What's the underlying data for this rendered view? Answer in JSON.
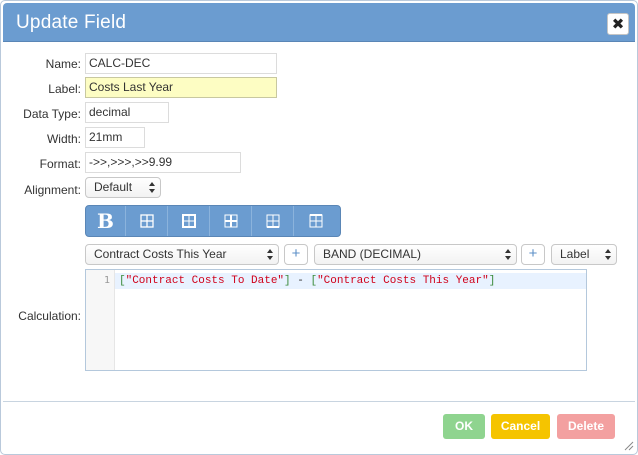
{
  "dialog": {
    "title": "Update Field",
    "close_icon": "close-icon"
  },
  "form": {
    "name": {
      "label": "Name:",
      "value": "CALC-DEC"
    },
    "label": {
      "label": "Label:",
      "value": "Costs Last Year"
    },
    "data_type": {
      "label": "Data Type:",
      "value": "decimal"
    },
    "width": {
      "label": "Width:",
      "value": "21mm"
    },
    "format": {
      "label": "Format:",
      "value": "->>,>>>,>>9.99"
    },
    "alignment": {
      "label": "Alignment:",
      "value": "Default"
    }
  },
  "toolbar": {
    "bold_label": "B",
    "icons": [
      "bold-icon",
      "border-all-icon",
      "border-outer-icon",
      "border-inner-icon",
      "border-bottom-icon",
      "border-top-icon"
    ]
  },
  "calc_row": {
    "field_select": "Contract Costs This Year",
    "band_select": "BAND (DECIMAL)",
    "type_select": "Label",
    "plus": "+"
  },
  "calculation": {
    "label": "Calculation:",
    "line_number": "1",
    "tokens": {
      "open1": "[",
      "str1": "\"Contract Costs To Date\"",
      "close1": "]",
      "op": " - ",
      "open2": "[",
      "str2": "\"Contract Costs This Year\"",
      "close2": "]"
    }
  },
  "buttons": {
    "ok": "OK",
    "cancel": "Cancel",
    "delete": "Delete"
  },
  "colors": {
    "titlebar": "#6b9cd0",
    "ok": "#8fd48f",
    "cancel": "#f5c400",
    "delete": "#f3a0a0",
    "string": "#d0021b",
    "bracket": "#3a8a3a"
  }
}
